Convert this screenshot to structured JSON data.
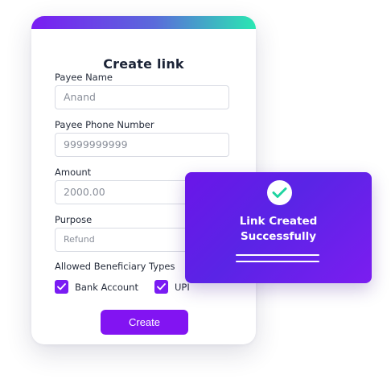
{
  "form": {
    "title": "Create link",
    "payee_name": {
      "label": "Payee Name",
      "placeholder": "Anand"
    },
    "payee_phone": {
      "label": "Payee Phone Number",
      "placeholder": "9999999999"
    },
    "amount": {
      "label": "Amount",
      "placeholder": "2000.00"
    },
    "purpose": {
      "label": "Purpose",
      "placeholder": "Refund"
    },
    "beneficiary": {
      "label": "Allowed Beneficiary Types",
      "options": [
        {
          "label": "Bank Account",
          "checked": true
        },
        {
          "label": "UPI",
          "checked": true
        }
      ]
    },
    "create_label": "Create"
  },
  "toast": {
    "line1": "Link Created",
    "line2": "Successfully",
    "icon": "check-circle-icon"
  },
  "colors": {
    "accent": "#7a1cf3",
    "button": "#8214f2",
    "gradient_start": "#7a1cf3",
    "gradient_end": "#2ae7b2",
    "toast_check": "#1fd4a0"
  }
}
